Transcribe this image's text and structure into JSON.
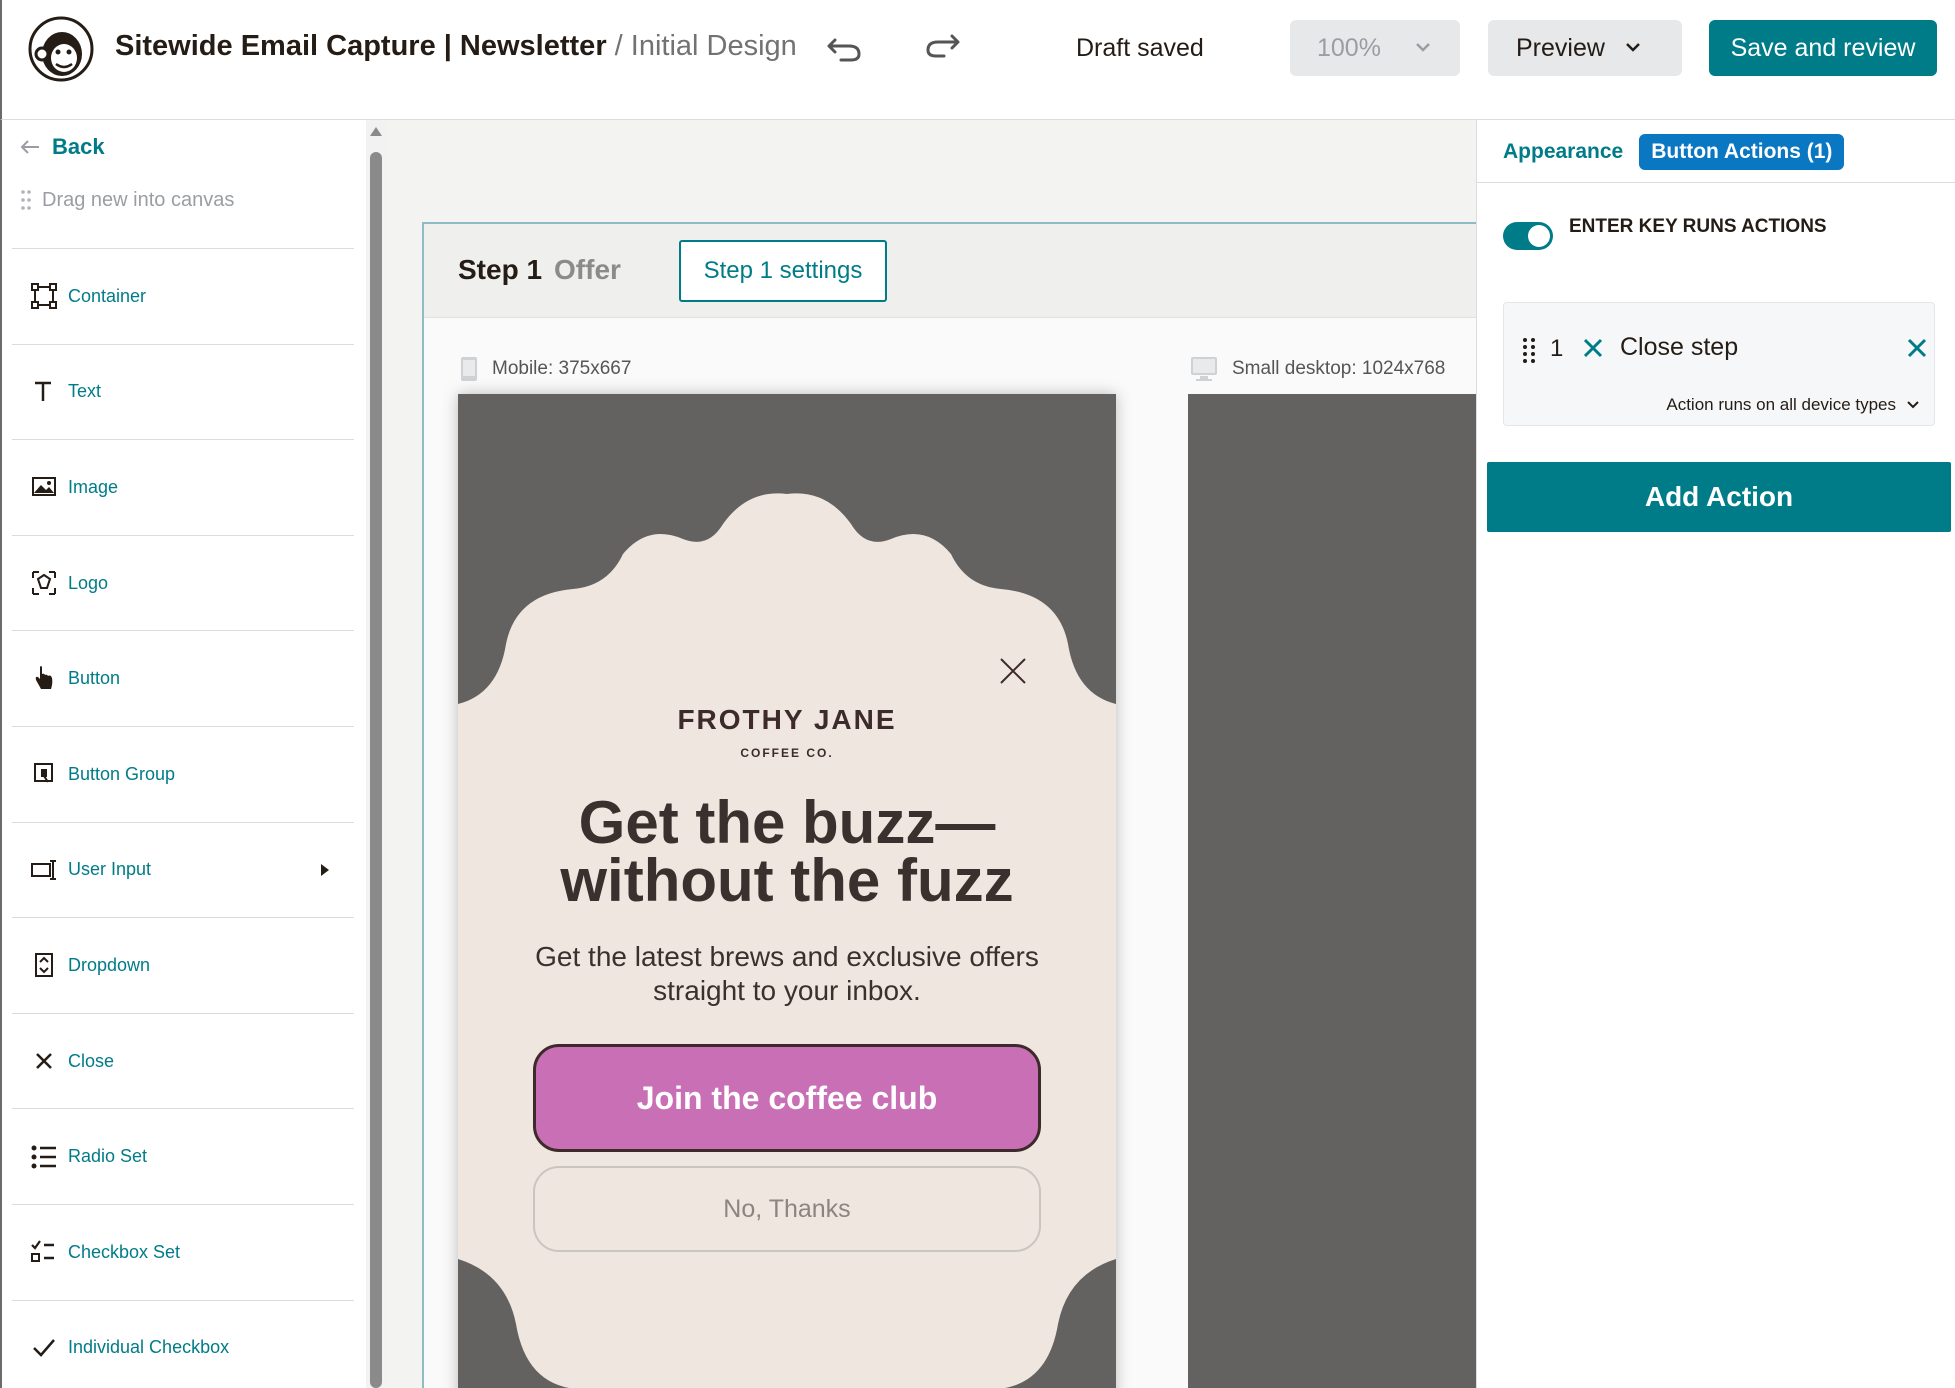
{
  "header": {
    "title_main": "Sitewide Email Capture | Newsletter",
    "title_sub": " / Initial Design",
    "draft_status": "Draft saved",
    "zoom": "100%",
    "preview_label": "Preview",
    "save_label": "Save and review"
  },
  "sidebar": {
    "back_label": "Back",
    "drag_hint": "Drag new into canvas",
    "items": [
      {
        "label": "Container",
        "icon": "container-icon"
      },
      {
        "label": "Text",
        "icon": "text-icon"
      },
      {
        "label": "Image",
        "icon": "image-icon"
      },
      {
        "label": "Logo",
        "icon": "logo-icon"
      },
      {
        "label": "Button",
        "icon": "pointer-icon"
      },
      {
        "label": "Button Group",
        "icon": "button-group-icon"
      },
      {
        "label": "User Input",
        "icon": "user-input-icon"
      },
      {
        "label": "Dropdown",
        "icon": "dropdown-icon"
      },
      {
        "label": "Close",
        "icon": "close-icon"
      },
      {
        "label": "Radio Set",
        "icon": "radio-set-icon"
      },
      {
        "label": "Checkbox Set",
        "icon": "checkbox-set-icon"
      },
      {
        "label": "Individual Checkbox",
        "icon": "checkmark-icon"
      }
    ]
  },
  "canvas": {
    "step_label": "Step 1",
    "step_name": "Offer",
    "step_settings_label": "Step 1 settings",
    "mobile_label": "Mobile: 375x667",
    "desktop_label": "Small desktop: 1024x768",
    "popup": {
      "brand": "FROTHY JANE",
      "brand_sub": "COFFEE CO.",
      "headline_line1": "Get the buzz—",
      "headline_line2": "without the fuzz",
      "subhead": "Get the latest brews and exclusive offers straight to your inbox.",
      "primary_button": "Join the coffee club",
      "secondary_button": "No, Thanks"
    }
  },
  "panel": {
    "tab_appearance": "Appearance",
    "tab_actions": "Button Actions (1)",
    "toggle_label": "ENTER KEY RUNS ACTIONS",
    "action": {
      "index": "1",
      "title": "Close step",
      "runs_on": "Action runs on all device types"
    },
    "add_action_label": "Add Action"
  },
  "colors": {
    "accent": "#007c89",
    "tab_active": "#0a77c2",
    "popup_bg": "#efe6df",
    "popup_button": "#c96fb5",
    "canvas_overlay": "#646260"
  }
}
